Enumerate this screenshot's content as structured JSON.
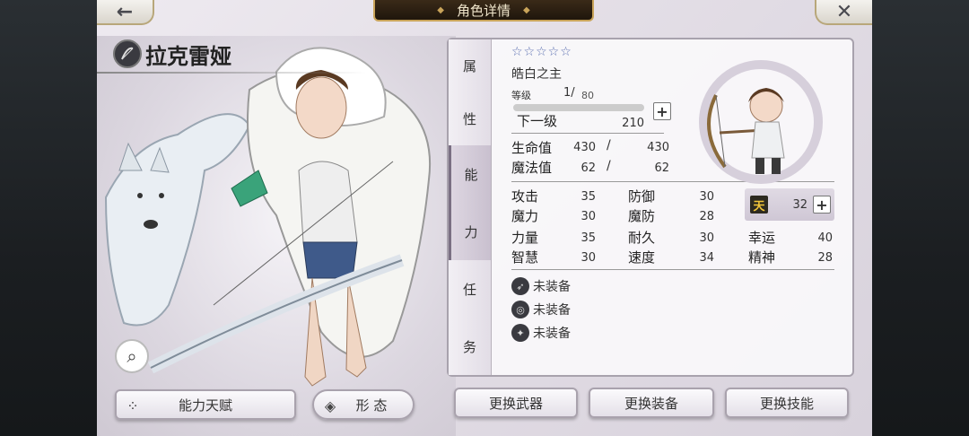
{
  "header": {
    "title": "角色详情",
    "back_icon": "←",
    "close_icon": "✕"
  },
  "character": {
    "name": "拉克雷娅",
    "class_icon": "bow-class-icon",
    "stars": "☆☆☆☆☆",
    "epithet": "皓白之主",
    "level_label": "等级",
    "level": "1",
    "level_max": "80",
    "level_progress": 0,
    "next_label": "下一级",
    "next_value": "210"
  },
  "tabs": [
    {
      "chars": [
        "属",
        "性"
      ]
    },
    {
      "chars": [
        "能",
        "力"
      ]
    },
    {
      "chars": [
        "任",
        "务"
      ]
    }
  ],
  "stats": {
    "hp_label": "生命值",
    "hp": "430",
    "hp_max": "430",
    "mp_label": "魔法值",
    "mp": "62",
    "mp_max": "62",
    "slash": "/",
    "attack_label": "攻击",
    "attack": "35",
    "defense_label": "防御",
    "defense": "30",
    "magic_label": "魔力",
    "magic": "30",
    "mdef_label": "魔防",
    "mdef": "28",
    "str_label": "力量",
    "str": "35",
    "endure_label": "耐久",
    "endure": "30",
    "luck_label": "幸运",
    "luck": "40",
    "wis_label": "智慧",
    "wis": "30",
    "speed_label": "速度",
    "speed": "34",
    "spirit_label": "精神",
    "spirit": "28",
    "heaven_icon": "天",
    "heaven_value": "32"
  },
  "equipment": [
    {
      "icon": "bow-slot-icon",
      "label": "未装备"
    },
    {
      "icon": "ring-slot-icon",
      "label": "未装备"
    },
    {
      "icon": "gem-slot-icon",
      "label": "未装备"
    }
  ],
  "buttons": {
    "talent": "能力天赋",
    "form": "形 态",
    "change_weapon": "更换武器",
    "change_equip": "更换装备",
    "change_skill": "更换技能"
  },
  "colors": {
    "accent_gold": "#c9a45a",
    "star_blue": "#5b6fb0",
    "panel_border": "#a8a2ad"
  }
}
